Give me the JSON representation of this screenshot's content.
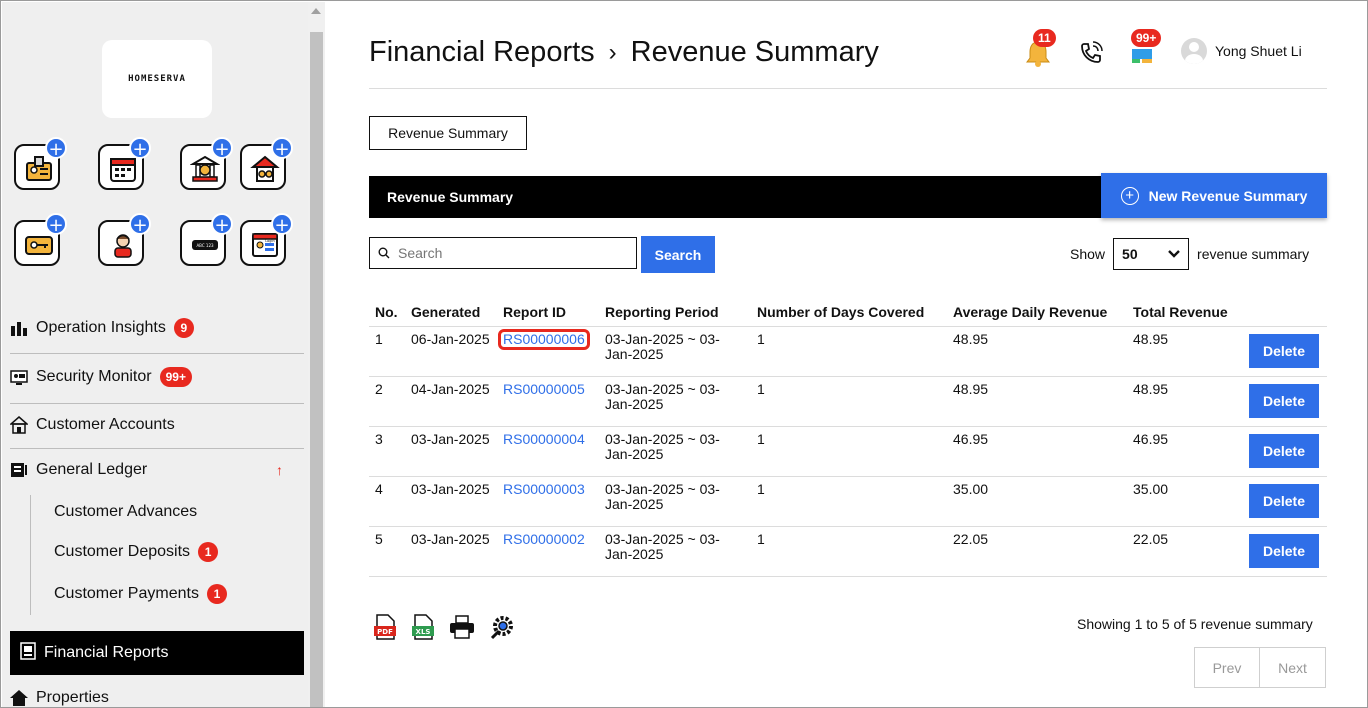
{
  "sidebar": {
    "logo_text": "HOMESERVA",
    "nav": {
      "operation_insights": {
        "label": "Operation Insights",
        "badge": "9"
      },
      "security_monitor": {
        "label": "Security Monitor",
        "badge": "99+"
      },
      "customer_accounts": {
        "label": "Customer Accounts"
      },
      "general_ledger": {
        "label": "General Ledger",
        "indicator": "↑"
      },
      "customer_advances": {
        "label": "Customer Advances"
      },
      "customer_deposits": {
        "label": "Customer Deposits",
        "badge": "1"
      },
      "customer_payments": {
        "label": "Customer Payments",
        "badge": "1"
      },
      "financial_reports": {
        "label": "Financial Reports"
      },
      "properties": {
        "label": "Properties"
      }
    },
    "quick_add_icons": [
      "staff-id-icon",
      "calendar-icon",
      "bank-finance-icon",
      "house-finance-icon",
      "access-card-icon",
      "resident-icon",
      "license-plate-icon",
      "login-screen-icon"
    ],
    "quick_add_texts": {
      "plate": "ABC 123",
      "login": "Login"
    }
  },
  "header": {
    "breadcrumb_parent": "Financial Reports",
    "breadcrumb_sep": "›",
    "breadcrumb_current": "Revenue Summary",
    "notifications_count": "11",
    "messages_count": "99+",
    "user_name": "Yong Shuet Li"
  },
  "tabs": {
    "revenue_summary": "Revenue Summary"
  },
  "section": {
    "title": "Revenue Summary",
    "new_button": "New Revenue Summary"
  },
  "controls": {
    "search_placeholder": "Search",
    "search_button": "Search",
    "show_label": "Show",
    "page_size": "50",
    "show_suffix": "revenue summary"
  },
  "table": {
    "headers": [
      "No.",
      "Generated",
      "Report ID",
      "Reporting Period",
      "Number of Days Covered",
      "Average Daily Revenue",
      "Total Revenue"
    ],
    "delete_label": "Delete",
    "rows": [
      {
        "no": "1",
        "generated": "06-Jan-2025",
        "report_id": "RS00000006",
        "period": "03-Jan-2025 ~ 03-Jan-2025",
        "days": "1",
        "avg": "48.95",
        "total": "48.95"
      },
      {
        "no": "2",
        "generated": "04-Jan-2025",
        "report_id": "RS00000005",
        "period": "03-Jan-2025 ~ 03-Jan-2025",
        "days": "1",
        "avg": "48.95",
        "total": "48.95"
      },
      {
        "no": "3",
        "generated": "03-Jan-2025",
        "report_id": "RS00000004",
        "period": "03-Jan-2025 ~ 03-Jan-2025",
        "days": "1",
        "avg": "46.95",
        "total": "46.95"
      },
      {
        "no": "4",
        "generated": "03-Jan-2025",
        "report_id": "RS00000003",
        "period": "03-Jan-2025 ~ 03-Jan-2025",
        "days": "1",
        "avg": "35.00",
        "total": "35.00"
      },
      {
        "no": "5",
        "generated": "03-Jan-2025",
        "report_id": "RS00000002",
        "period": "03-Jan-2025 ~ 03-Jan-2025",
        "days": "1",
        "avg": "22.05",
        "total": "22.05"
      }
    ]
  },
  "footer": {
    "export_icons": [
      "pdf-icon",
      "xls-icon",
      "print-icon",
      "settings-icon"
    ],
    "pdf_text": "PDF",
    "xls_text": "XLS",
    "showing_text": "Showing 1 to 5 of 5 revenue summary",
    "prev": "Prev",
    "next": "Next"
  },
  "colors": {
    "accent": "#2f6fe8",
    "badge": "#e8291f",
    "highlight": "#e8291f"
  }
}
